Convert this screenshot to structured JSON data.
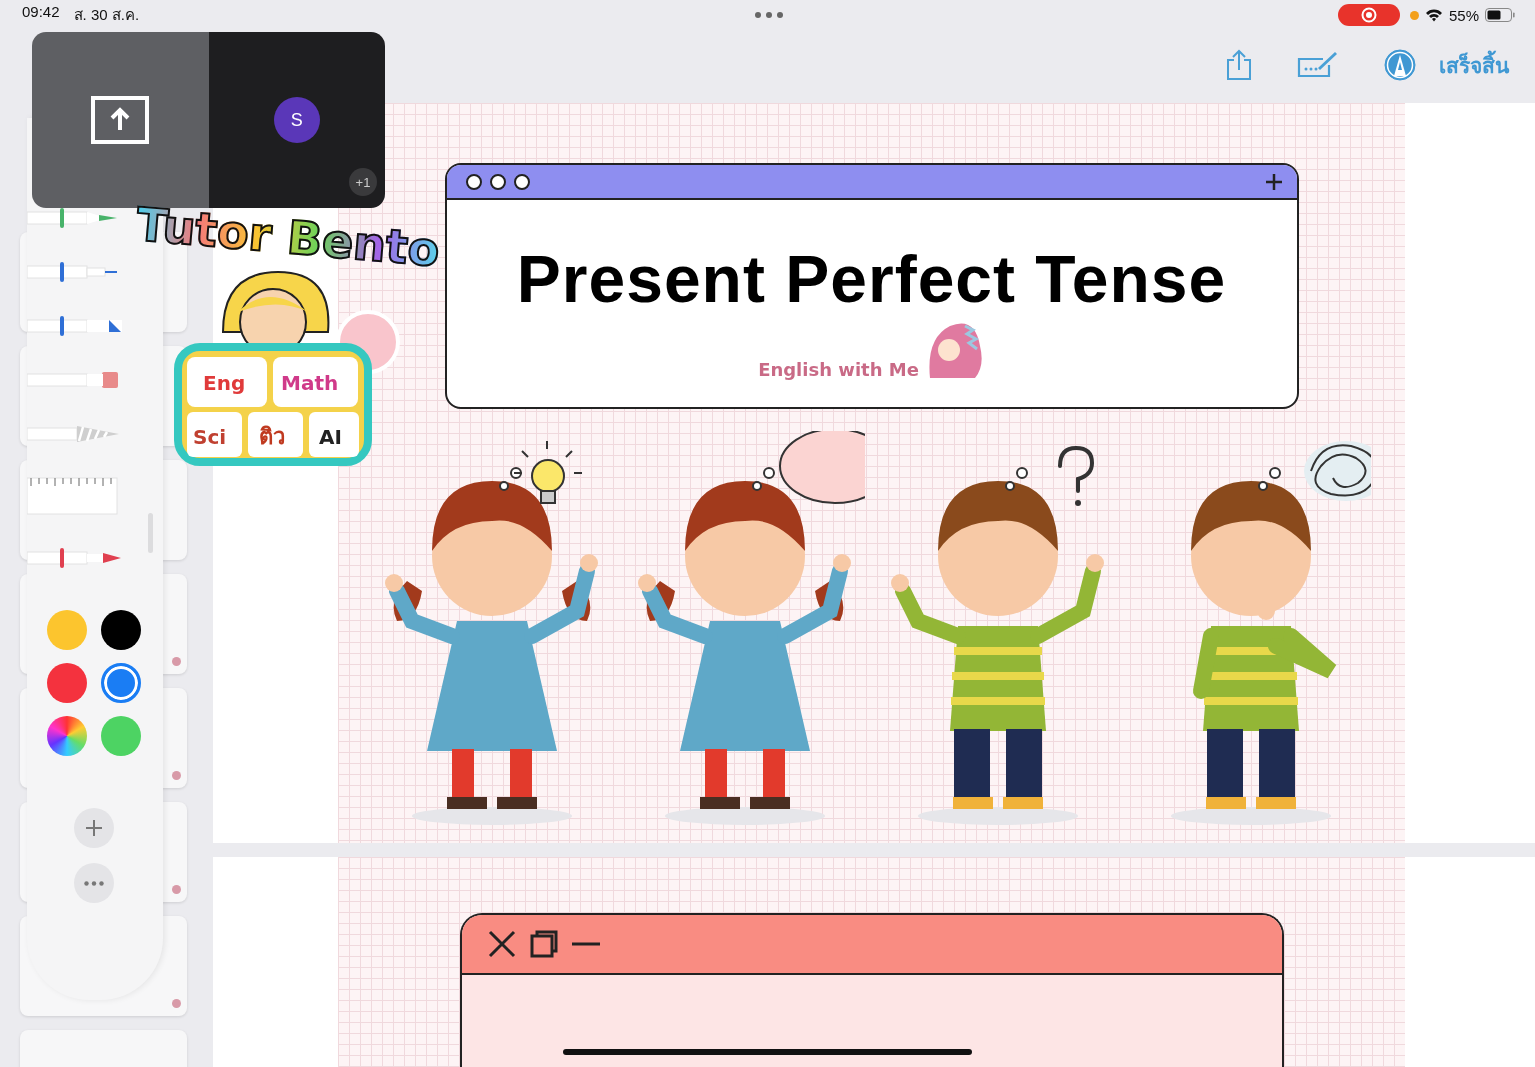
{
  "status_bar": {
    "time": "09:42",
    "date": "ส. 30 ส.ค.",
    "battery_text": "55%"
  },
  "toolbar": {
    "done_label": "เสร็จสิ้น"
  },
  "call_overlay": {
    "avatar_initial": "S",
    "extra_count": "+1"
  },
  "sticker": {
    "title": "Tutor Bento",
    "labels": [
      "Eng",
      "Math",
      "Sci",
      "ติว",
      "AI"
    ]
  },
  "palette": {
    "colors": [
      {
        "kind": "swatch",
        "color": "#fcc52e",
        "selected": false
      },
      {
        "kind": "swatch",
        "color": "#000000",
        "selected": false
      },
      {
        "kind": "swatch",
        "color": "#f4323e",
        "selected": false
      },
      {
        "kind": "swatch",
        "color": "#1a7df4",
        "selected": true
      },
      {
        "kind": "wheel",
        "selected": false
      },
      {
        "kind": "swatch",
        "color": "#4dd363",
        "selected": false
      }
    ]
  },
  "slides": [
    {
      "kind": "title",
      "title": "Present Perfect Tense",
      "subtitle": "English with Me",
      "characters": [
        {
          "kind": "girl"
        },
        {
          "kind": "girl"
        },
        {
          "kind": "boy"
        },
        {
          "kind": "boy"
        }
      ],
      "thoughts": [
        {
          "kind": "bulb"
        },
        {
          "kind": "bubble"
        },
        {
          "kind": "question"
        },
        {
          "kind": "scribble"
        }
      ]
    },
    {
      "kind": "window"
    }
  ]
}
